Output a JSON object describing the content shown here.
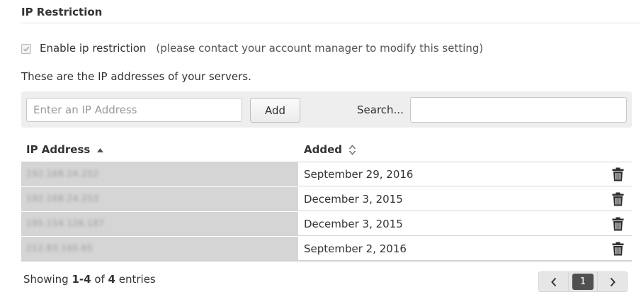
{
  "section": {
    "title": "IP Restriction"
  },
  "restriction": {
    "checked": true,
    "label": "Enable ip restriction",
    "note": "(please contact your account manager to modify this setting)"
  },
  "intro": "These are the IP addresses of your servers.",
  "toolbar": {
    "ip_placeholder": "Enter an IP Address",
    "ip_value": "",
    "add_label": "Add",
    "search_label": "Search...",
    "search_value": ""
  },
  "table": {
    "columns": [
      {
        "label": "IP Address",
        "sort": "ascending"
      },
      {
        "label": "Added",
        "sort": "none"
      }
    ],
    "rows": [
      {
        "ip": "192.168.24.252",
        "added": "September 29, 2016"
      },
      {
        "ip": "192.168.24.253",
        "added": "December 3, 2015"
      },
      {
        "ip": "195.154.126.187",
        "added": "December 3, 2015"
      },
      {
        "ip": "212.83.160.65",
        "added": "September 2, 2016"
      }
    ]
  },
  "footer": {
    "showing_prefix": "Showing ",
    "range": "1-4",
    "of_text": " of ",
    "total": "4",
    "entries_text": " entries"
  },
  "pagination": {
    "current_page": "1"
  },
  "icons": {
    "checkbox": "check-icon",
    "sort_asc": "sort-ascending-icon",
    "sort_both": "sort-both-icon",
    "delete": "trash-icon",
    "prev": "chevron-left-icon",
    "next": "chevron-right-icon"
  },
  "colors": {
    "masked_cell": "#d5d5d5",
    "toolbar_bg": "#eeeeee",
    "active_page": "#505050"
  }
}
